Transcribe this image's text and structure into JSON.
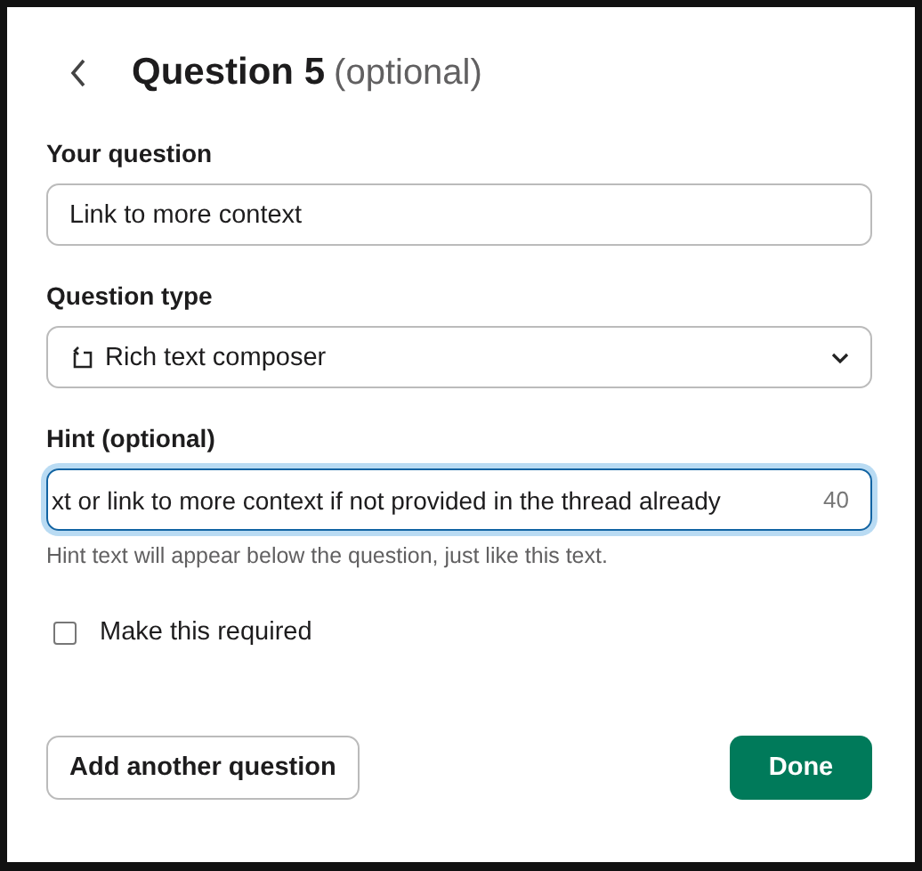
{
  "header": {
    "title": "Question 5",
    "suffix": "(optional)"
  },
  "fields": [
    {
      "kind": "text",
      "label": "Your question",
      "value": "Link to more context",
      "focused": false
    },
    {
      "kind": "select",
      "label": "Question type",
      "value": "Rich text composer",
      "focused": false
    },
    {
      "kind": "text",
      "label": "Hint (optional)",
      "value": "xt or link to more context if not provided in the thread already",
      "counter": "40",
      "help": "Hint text will appear below the question, just like this text.",
      "focused": true
    }
  ],
  "required": {
    "label": "Make this required",
    "checked": false
  },
  "buttons": {
    "secondary": "Add another question",
    "primary": "Done"
  }
}
